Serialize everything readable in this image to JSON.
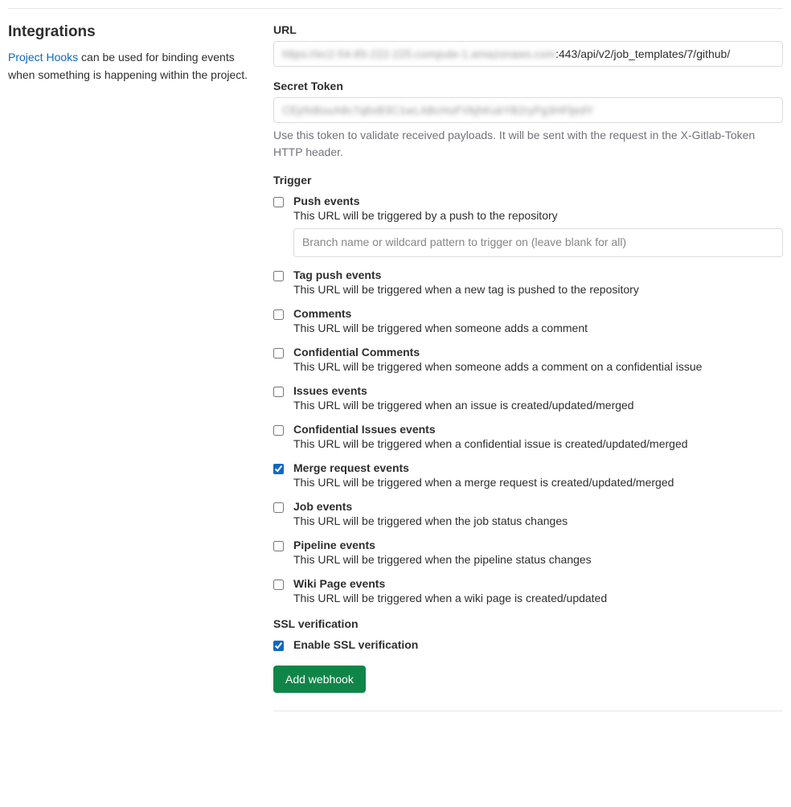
{
  "sidebar": {
    "title": "Integrations",
    "link_text": "Project Hooks",
    "description_rest": " can be used for binding events when something is happening within the project."
  },
  "url": {
    "label": "URL",
    "masked": "https://ec2-54-85-222-225.compute-1.amazonaws.com",
    "visible": ":443/api/v2/job_templates/7/github/"
  },
  "secret": {
    "label": "Secret Token",
    "masked": "CEjrfoBouA8c7q6xB3C1wLABcHuFVkjhKukYB2ryPg3HFljedY",
    "help": "Use this token to validate received payloads. It will be sent with the request in the X-Gitlab-Token HTTP header."
  },
  "trigger_label": "Trigger",
  "triggers": [
    {
      "key": "push",
      "title": "Push events",
      "desc": "This URL will be triggered by a push to the repository",
      "checked": false,
      "has_input": true,
      "placeholder": "Branch name or wildcard pattern to trigger on (leave blank for all)"
    },
    {
      "key": "tag_push",
      "title": "Tag push events",
      "desc": "This URL will be triggered when a new tag is pushed to the repository",
      "checked": false
    },
    {
      "key": "comments",
      "title": "Comments",
      "desc": "This URL will be triggered when someone adds a comment",
      "checked": false
    },
    {
      "key": "confidential_comments",
      "title": "Confidential Comments",
      "desc": "This URL will be triggered when someone adds a comment on a confidential issue",
      "checked": false
    },
    {
      "key": "issues",
      "title": "Issues events",
      "desc": "This URL will be triggered when an issue is created/updated/merged",
      "checked": false
    },
    {
      "key": "confidential_issues",
      "title": "Confidential Issues events",
      "desc": "This URL will be triggered when a confidential issue is created/updated/merged",
      "checked": false
    },
    {
      "key": "merge_request",
      "title": "Merge request events",
      "desc": "This URL will be triggered when a merge request is created/updated/merged",
      "checked": true
    },
    {
      "key": "job",
      "title": "Job events",
      "desc": "This URL will be triggered when the job status changes",
      "checked": false
    },
    {
      "key": "pipeline",
      "title": "Pipeline events",
      "desc": "This URL will be triggered when the pipeline status changes",
      "checked": false
    },
    {
      "key": "wiki",
      "title": "Wiki Page events",
      "desc": "This URL will be triggered when a wiki page is created/updated",
      "checked": false
    }
  ],
  "ssl": {
    "section_label": "SSL verification",
    "title": "Enable SSL verification",
    "checked": true
  },
  "submit_label": "Add webhook"
}
